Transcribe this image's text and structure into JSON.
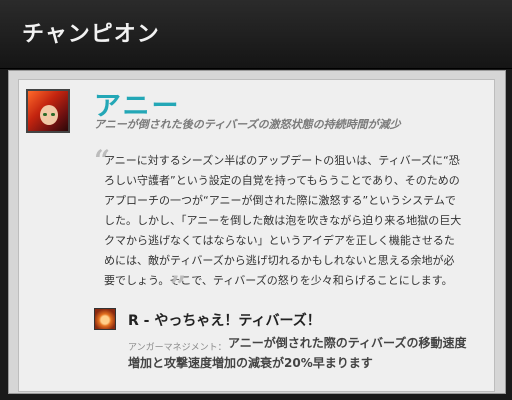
{
  "header": {
    "title": "チャンピオン"
  },
  "champion": {
    "name": "アニー",
    "subtitle": "アニーが倒された後のティバーズの激怒状態の持続時間が減少",
    "quote_mark_open": "“",
    "quote_mark_close": "”",
    "quote": "アニーに対するシーズン半ばのアップデートの狙いは、ティバーズに“恐ろしい守護者”という設定の自覚を持ってもらうことであり、そのためのアプローチの一つが“アニーが倒された際に激怒する”というシステムでした。しかし、「アニーを倒した敵は泡を吹きながら迫り来る地獄の巨大クマから逃げなくてはならない」というアイデアを正しく機能させるためには、敵がティバーズから逃げ切れるかもしれないと思える余地が必要でしょう。そこで、ティバーズの怒りを少々和らげることにします。"
  },
  "ability": {
    "icon": "tibbers-ability-icon",
    "title": "R - やっちゃえ！ティバーズ！",
    "label": "アンガーマネジメント：",
    "description": "アニーが倒された際のティバーズの移動速度増加と攻撃速度増加の減衰が20%早まります"
  },
  "colors": {
    "champion_name": "#23a7b6",
    "header_bg": "#1f1f1f",
    "panel_bg": "#efefef"
  }
}
